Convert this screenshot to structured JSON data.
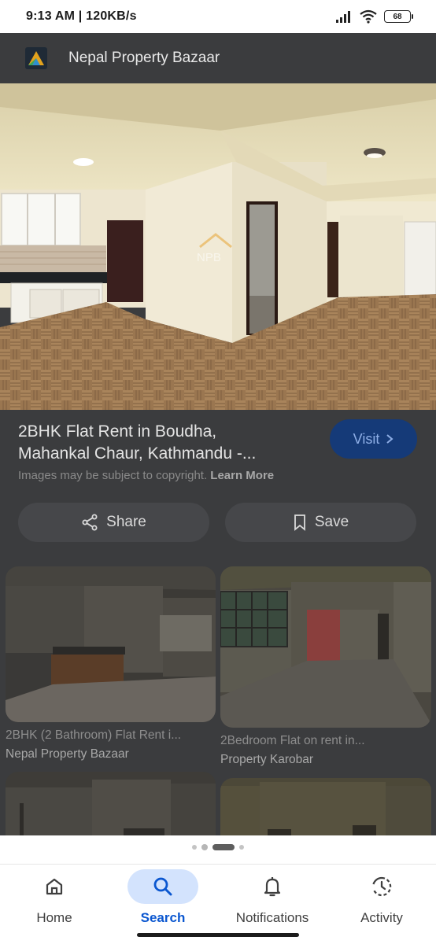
{
  "status_bar": {
    "time": "9:13 AM | 120KB/s",
    "battery": "68"
  },
  "app_bar": {
    "title": "Nepal Property Bazaar"
  },
  "hero": {
    "watermark": "NPB"
  },
  "listing": {
    "title_line1": "2BHK Flat Rent in Boudha,",
    "title_line2": "Mahankal Chaur, Kathmandu -...",
    "visit_label": "Visit",
    "copyright_text": "Images may be subject to copyright.",
    "learn_more": "Learn More",
    "share_label": "Share",
    "save_label": "Save"
  },
  "results": [
    {
      "title": "2BHK (2 Bathroom) Flat Rent i...",
      "source": "Nepal Property Bazaar"
    },
    {
      "title": "2Bedroom Flat on rent in...",
      "source": "Property Karobar"
    }
  ],
  "nav": {
    "home": "Home",
    "search": "Search",
    "notifications": "Notifications",
    "activity": "Activity"
  },
  "colors": {
    "accent": "#0b57d0",
    "active_pill": "#d3e3fd",
    "overlay": "#3b3c3e"
  }
}
